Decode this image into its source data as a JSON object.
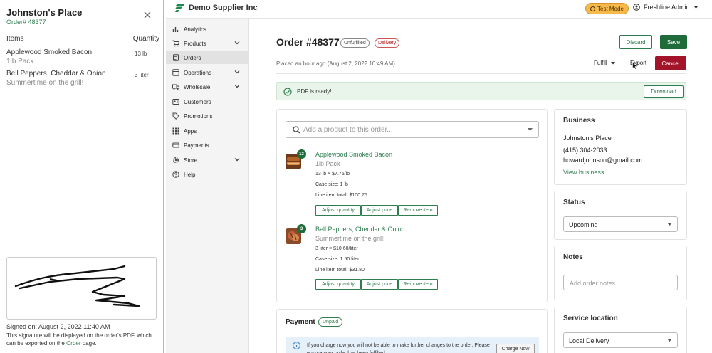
{
  "pdf_panel": {
    "title": "Johnston's Place",
    "order_number": "Order# 48377",
    "items_header": "Items",
    "quantity_header": "Quantity",
    "items": [
      {
        "name": "Applewood Smoked Bacon",
        "sub": "1lb Pack",
        "qty": "13 lb"
      },
      {
        "name": "Bell Peppers, Cheddar & Onion",
        "sub": "Summertime on the grill!",
        "qty": "3 liter"
      }
    ],
    "signed_on": "Signed on: August 2, 2022 11:40 AM",
    "sig_note_pre": "This signature will be displayed on the order's PDF, which can be exported on the ",
    "sig_note_link": "Order",
    "sig_note_post": " page."
  },
  "topbar": {
    "brand": "Demo Supplier Inc",
    "test_mode": "Test Mode",
    "admin": "Freshline Admin"
  },
  "sidebar": {
    "items": [
      {
        "label": "Analytics",
        "icon": "chart-icon"
      },
      {
        "label": "Products",
        "icon": "cart-icon"
      },
      {
        "label": "Orders",
        "icon": "orders-icon"
      },
      {
        "label": "Operations",
        "icon": "operations-icon"
      },
      {
        "label": "Wholesale",
        "icon": "truck-icon"
      },
      {
        "label": "Customers",
        "icon": "customers-icon"
      },
      {
        "label": "Promotions",
        "icon": "tag-icon"
      },
      {
        "label": "Apps",
        "icon": "grid-icon"
      },
      {
        "label": "Payments",
        "icon": "payments-icon"
      },
      {
        "label": "Store",
        "icon": "gear-icon"
      },
      {
        "label": "Help",
        "icon": "help-icon"
      }
    ]
  },
  "order": {
    "title": "Order #48377",
    "badge_fulfillment": "Unfulfilled",
    "badge_delivery": "Delivery",
    "discard": "Discard",
    "save": "Save",
    "placed": "Placed an hour ago (August 2, 2022 10:49 AM)",
    "fulfill": "Fulfill",
    "export": "Export",
    "cancel": "Cancel",
    "pdf_ready": "PDF is ready!",
    "download": "Download",
    "search_placeholder": "Add a product to this order...",
    "line_items": [
      {
        "qty_badge": "13",
        "name": "Applewood Smoked Bacon",
        "sub": "1lb Pack",
        "price_line": "13 lb × $7.75/lb",
        "case_size": "Case size: 1 lb",
        "total": "Line item total: $100.75"
      },
      {
        "qty_badge": "3",
        "name": "Bell Peppers, Cheddar & Onion",
        "sub": "Summertime on the grill!",
        "price_line": "3 liter × $10.60/liter",
        "case_size": "Case size: 1.50 liter",
        "total": "Line item total: $31.80"
      }
    ],
    "adjust_quantity": "Adjust quantity",
    "adjust_price": "Adjust price",
    "remove_item": "Remove item",
    "payment_title": "Payment",
    "payment_badge": "Unpaid",
    "payment_notice": "If you charge now you will not be able to make further changes to the order. Please ensure your order has been fulfilled.",
    "charge_now": "Charge Now"
  },
  "business": {
    "title": "Business",
    "name": "Johnston's Place",
    "phone": "(415) 304-2033",
    "email": "howardjohnson@gmail.com",
    "link": "View business"
  },
  "status": {
    "title": "Status",
    "value": "Upcoming"
  },
  "notes": {
    "title": "Notes",
    "placeholder": "Add order notes"
  },
  "service": {
    "title": "Service location",
    "value": "Local Delivery"
  },
  "colors": {
    "brand_green": "#1f6b3a",
    "cancel_red": "#a3132a",
    "test_mode": "#f6b94a"
  }
}
